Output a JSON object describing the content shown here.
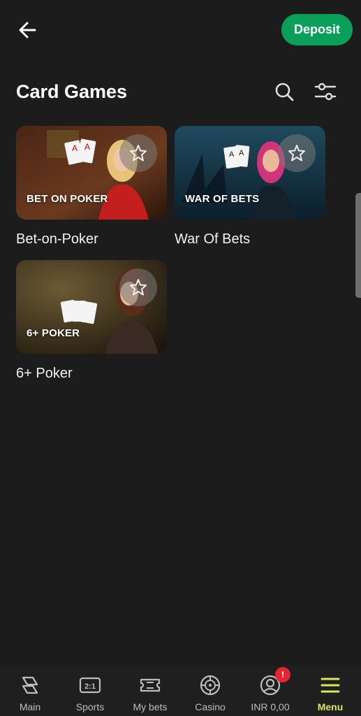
{
  "header": {
    "deposit_label": "Deposit",
    "title": "Card Games"
  },
  "games": [
    {
      "label": "Bet-on-Poker",
      "thumb_title": "BET ON POKER"
    },
    {
      "label": "War Of Bets",
      "thumb_title": "WAR OF BETS"
    },
    {
      "label": "6+ Poker",
      "thumb_title": "6+ POKER"
    }
  ],
  "bottom_nav": {
    "items": [
      {
        "label": "Main",
        "icon": "main-icon"
      },
      {
        "label": "Sports",
        "icon": "sports-icon",
        "icon_text": "2:1"
      },
      {
        "label": "My bets",
        "icon": "ticket-icon"
      },
      {
        "label": "Casino",
        "icon": "roulette-icon"
      },
      {
        "label": "INR 0,00",
        "icon": "account-icon",
        "badge": "!"
      },
      {
        "label": "Menu",
        "icon": "menu-icon",
        "active": true
      }
    ]
  },
  "colors": {
    "background": "#1c1c1c",
    "deposit": "#0aa05a",
    "active_nav": "#d8e85a",
    "badge": "#e8242f"
  }
}
